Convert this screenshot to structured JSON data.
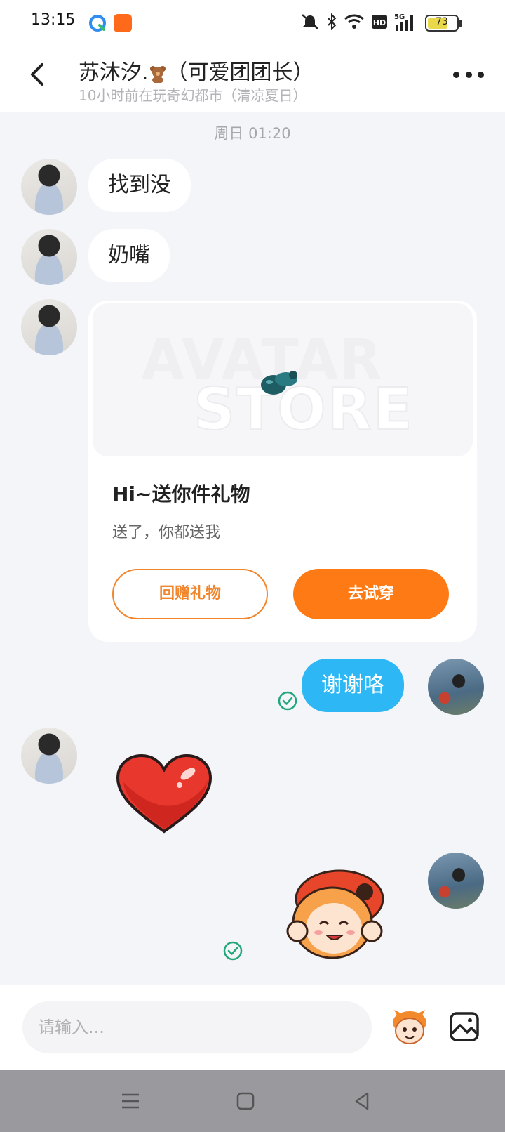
{
  "status_bar": {
    "time": "13:15",
    "battery": "73"
  },
  "header": {
    "title": "苏沐汐.",
    "title_suffix": "（可爱团团长）",
    "subtitle": "10小时前在玩奇幻都市（清凉夏日）"
  },
  "chat": {
    "timestamp": "周日 01:20",
    "messages": [
      {
        "text": "找到没"
      },
      {
        "text": "奶嘴"
      },
      {
        "text": "谢谢咯"
      }
    ],
    "gift_card": {
      "banner_line1": "AVATAR",
      "banner_line2": "STORE",
      "title": "Hi~送你件礼物",
      "description": "送了，你都送我",
      "return_gift_label": "回赠礼物",
      "try_on_label": "去试穿"
    }
  },
  "input": {
    "placeholder": "请输入..."
  },
  "colors": {
    "accent_orange": "#fd7a15",
    "my_bubble": "#2db8f5",
    "read_check": "#22a67a"
  }
}
